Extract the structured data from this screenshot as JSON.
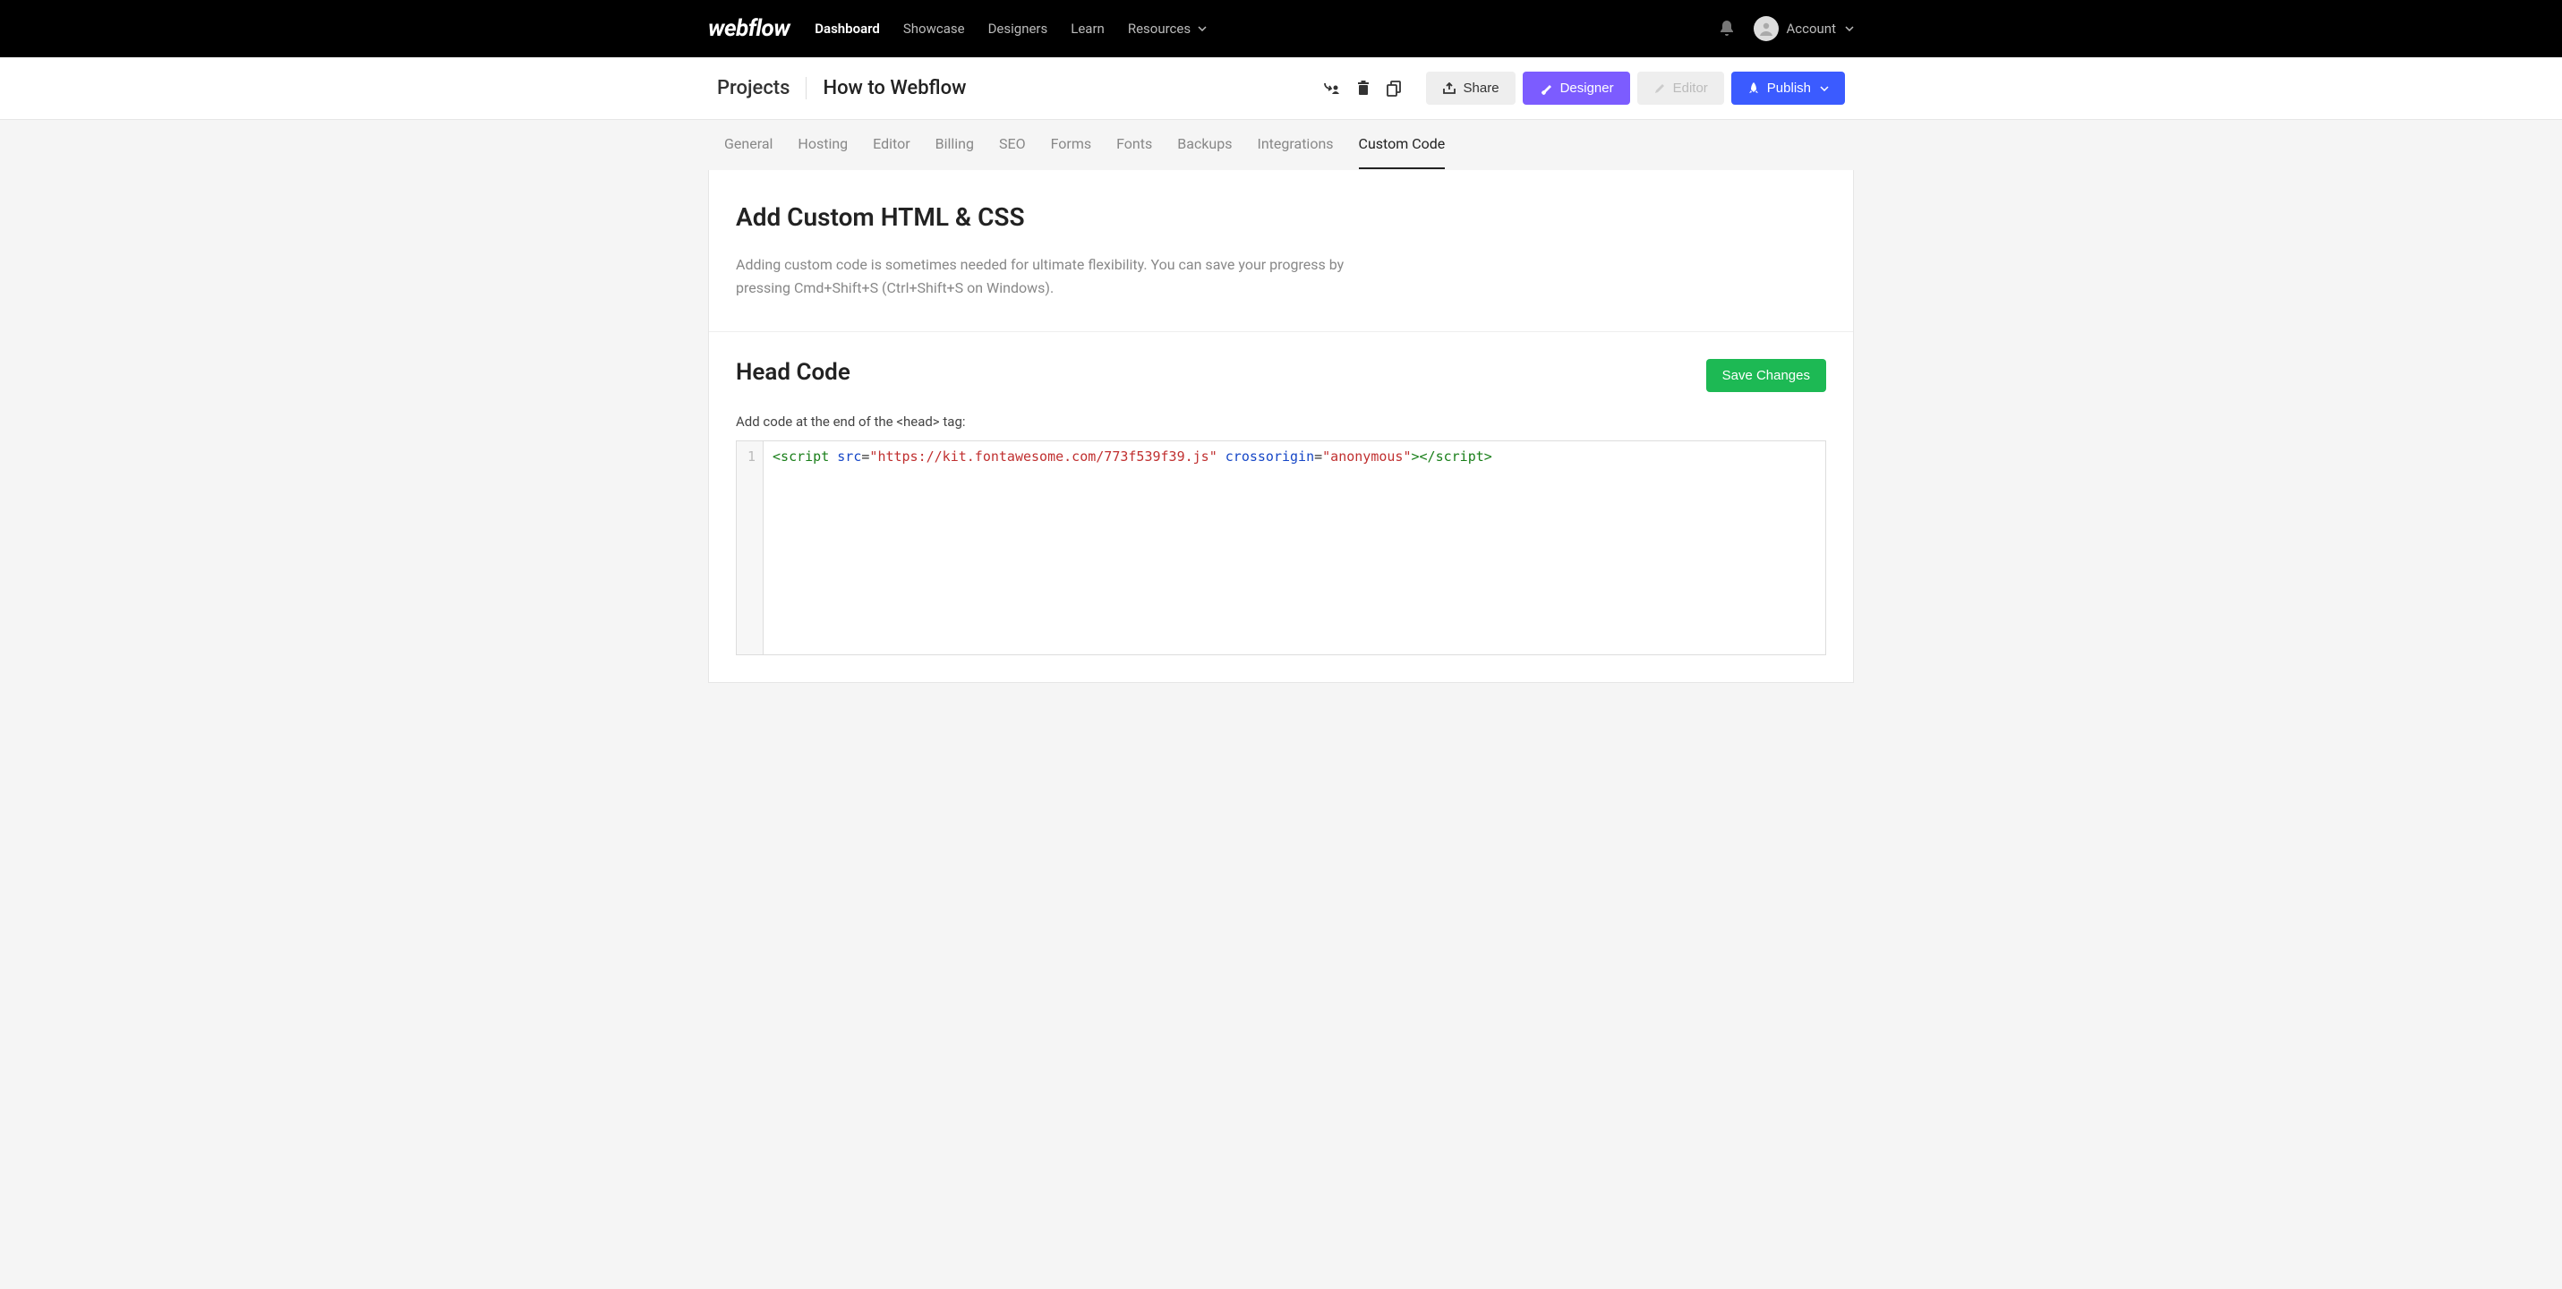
{
  "topnav": {
    "logo": "webflow",
    "links": [
      {
        "label": "Dashboard",
        "active": true
      },
      {
        "label": "Showcase",
        "active": false
      },
      {
        "label": "Designers",
        "active": false
      },
      {
        "label": "Learn",
        "active": false
      },
      {
        "label": "Resources",
        "active": false,
        "dropdown": true
      }
    ],
    "account_label": "Account"
  },
  "projectbar": {
    "root": "Projects",
    "project_name": "How to Webflow",
    "share_label": "Share",
    "designer_label": "Designer",
    "editor_label": "Editor",
    "publish_label": "Publish"
  },
  "tabs": [
    {
      "label": "General",
      "active": false
    },
    {
      "label": "Hosting",
      "active": false
    },
    {
      "label": "Editor",
      "active": false
    },
    {
      "label": "Billing",
      "active": false
    },
    {
      "label": "SEO",
      "active": false
    },
    {
      "label": "Forms",
      "active": false
    },
    {
      "label": "Fonts",
      "active": false
    },
    {
      "label": "Backups",
      "active": false
    },
    {
      "label": "Integrations",
      "active": false
    },
    {
      "label": "Custom Code",
      "active": true
    }
  ],
  "section": {
    "title": "Add Custom HTML & CSS",
    "description": "Adding custom code is sometimes needed for ultimate flexibility. You can save your progress by pressing Cmd+Shift+S (Ctrl+Shift+S on Windows)."
  },
  "headcode": {
    "title": "Head Code",
    "save_label": "Save Changes",
    "hint": "Add code at the end of the <head> tag:",
    "line_number": "1",
    "code_tokens": {
      "t1": "<script",
      "a1": "src",
      "eq": "=",
      "q": "\"",
      "s1": "https://kit.fontawesome.com/773f539f39.js",
      "a2": "crossorigin",
      "s2": "anonymous",
      "t2": ">",
      "t3": "</script",
      "t4": ">"
    }
  }
}
